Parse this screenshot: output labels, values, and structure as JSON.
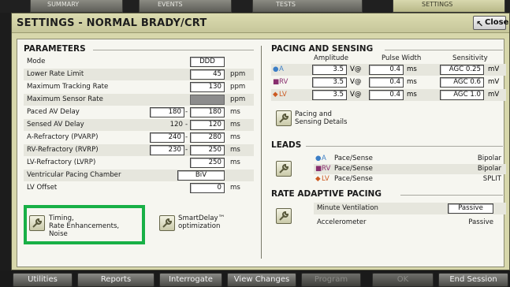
{
  "top_tabs": [
    {
      "label": "SUMMARY"
    },
    {
      "label": "EVENTS"
    },
    {
      "label": "TESTS"
    },
    {
      "label": "SETTINGS"
    }
  ],
  "window": {
    "title": "SETTINGS - NORMAL BRADY/CRT",
    "close_label": "Close"
  },
  "parameters": {
    "heading": "PARAMETERS",
    "rows": [
      {
        "label": "Mode",
        "value": "DDD",
        "unit": ""
      },
      {
        "label": "Lower Rate Limit",
        "value": "45",
        "unit": "ppm"
      },
      {
        "label": "Maximum Tracking Rate",
        "value": "130",
        "unit": "ppm"
      },
      {
        "label": "Maximum Sensor Rate",
        "value": "",
        "unit": "ppm"
      },
      {
        "label": "Paced AV Delay",
        "value_min": "180",
        "value": "180",
        "unit": "ms"
      },
      {
        "label": "Sensed AV Delay",
        "value_min": "120",
        "value": "120",
        "unit": "ms"
      },
      {
        "label": "A-Refractory (PVARP)",
        "value_min": "240",
        "value": "280",
        "unit": "ms"
      },
      {
        "label": "RV-Refractory (RVRP)",
        "value_min": "230",
        "value": "250",
        "unit": "ms"
      },
      {
        "label": "LV-Refractory (LVRP)",
        "value": "250",
        "unit": "ms"
      },
      {
        "label": "Ventricular Pacing Chamber",
        "value": "BiV",
        "unit": ""
      },
      {
        "label": "LV Offset",
        "value": "0",
        "unit": "ms"
      }
    ],
    "timing_button": {
      "line1": "Timing,",
      "line2": "Rate Enhancements,",
      "line3": "Noise"
    },
    "smartdelay_button": {
      "line1": "SmartDelay™",
      "line2": "optimization"
    }
  },
  "pacing_sensing": {
    "heading": "PACING AND SENSING",
    "col_amplitude": "Amplitude",
    "col_pulse": "Pulse Width",
    "col_sensitivity": "Sensitivity",
    "rows": [
      {
        "marker": "●",
        "chamber": "A",
        "amplitude": "3.5",
        "amp_unit": "V@",
        "pulse": "0.4",
        "pulse_unit": "ms",
        "sens": "AGC 0.25",
        "sens_unit": "mV"
      },
      {
        "marker": "■",
        "chamber": "RV",
        "amplitude": "3.5",
        "amp_unit": "V@",
        "pulse": "0.4",
        "pulse_unit": "ms",
        "sens": "AGC 0.6",
        "sens_unit": "mV"
      },
      {
        "marker": "◆",
        "chamber": "LV",
        "amplitude": "3.5",
        "amp_unit": "V@",
        "pulse": "0.4",
        "pulse_unit": "ms",
        "sens": "AGC 1.0",
        "sens_unit": "mV"
      }
    ],
    "details_button": {
      "line1": "Pacing and",
      "line2": "Sensing Details"
    }
  },
  "leads": {
    "heading": "LEADS",
    "rows": [
      {
        "marker": "●",
        "chamber": "A",
        "function": "Pace/Sense",
        "config": "Bipolar"
      },
      {
        "marker": "■",
        "chamber": "RV",
        "function": "Pace/Sense",
        "config": "Bipolar"
      },
      {
        "marker": "◆",
        "chamber": "LV",
        "function": "Pace/Sense",
        "config": "SPLIT"
      }
    ]
  },
  "rate_adaptive": {
    "heading": "RATE ADAPTIVE PACING",
    "minute_ventilation_label": "Minute Ventilation",
    "minute_ventilation_value": "Passive",
    "accelerometer_label": "Accelerometer",
    "accelerometer_value": "Passive"
  },
  "bottom_buttons": [
    {
      "label": "Utilities"
    },
    {
      "label": "Reports"
    },
    {
      "label": "Interrogate"
    },
    {
      "label": "View Changes"
    },
    {
      "label": "Program"
    },
    {
      "label": "OK"
    },
    {
      "label": "End Session"
    }
  ],
  "colors": {
    "highlight_box": "#18b046",
    "marker_a": "#3c7ec6",
    "marker_rv": "#882e6e",
    "marker_lv": "#cc5a22"
  }
}
